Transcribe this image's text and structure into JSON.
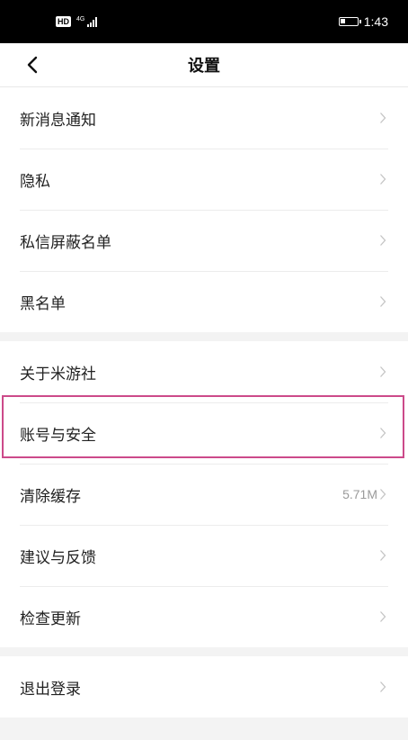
{
  "status_bar": {
    "hd_badge": "HD",
    "network": "4G",
    "time": "1:43",
    "battery_level": 0.3
  },
  "nav": {
    "title": "设置"
  },
  "groups": [
    {
      "items": [
        {
          "label": "新消息通知",
          "value": ""
        },
        {
          "label": "隐私",
          "value": ""
        },
        {
          "label": "私信屏蔽名单",
          "value": ""
        },
        {
          "label": "黑名单",
          "value": ""
        }
      ]
    },
    {
      "items": [
        {
          "label": "关于米游社",
          "value": ""
        },
        {
          "label": "账号与安全",
          "value": ""
        },
        {
          "label": "清除缓存",
          "value": "5.71M"
        },
        {
          "label": "建议与反馈",
          "value": ""
        },
        {
          "label": "检查更新",
          "value": ""
        }
      ]
    },
    {
      "items": [
        {
          "label": "退出登录",
          "value": ""
        }
      ]
    }
  ],
  "icons": {
    "back": "chevron-left-icon",
    "row_arrow": "chevron-right-icon"
  },
  "colors": {
    "highlight_border": "#cc4a8a",
    "status_bar_bg": "#000000",
    "page_bg": "#f3f3f3"
  }
}
